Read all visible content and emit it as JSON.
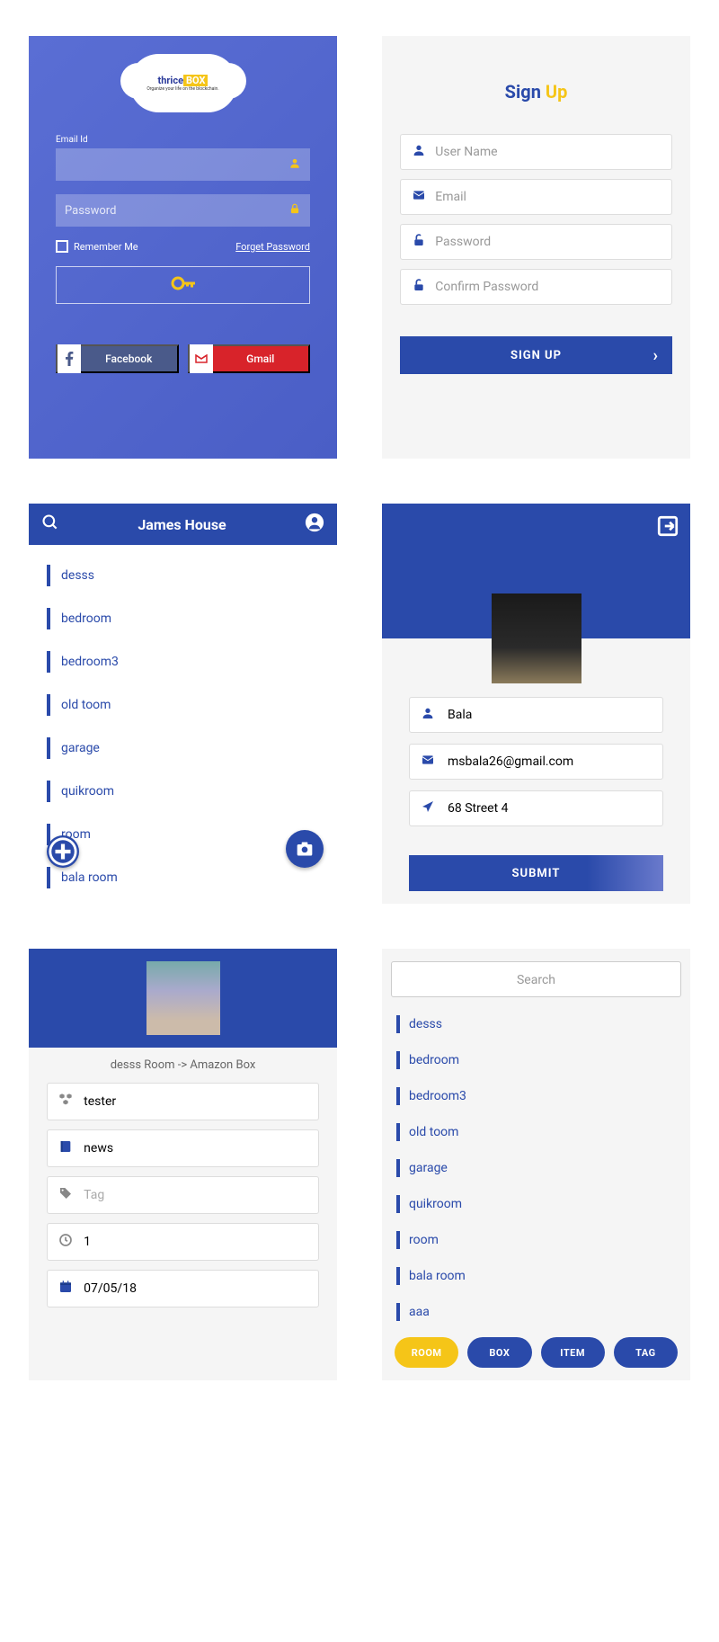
{
  "login": {
    "logo_text1": "thrice",
    "logo_text2": "BOX",
    "logo_sub": "Organize your life on the blockchain.",
    "email_label": "Email Id",
    "password_placeholder": "Password",
    "remember": "Remember Me",
    "forget": "Forget Password",
    "facebook": "Facebook",
    "gmail": "Gmail"
  },
  "signup": {
    "title1": "Sign",
    "title2": "Up",
    "username_ph": "User Name",
    "email_ph": "Email",
    "password_ph": "Password",
    "confirm_ph": "Confirm Password",
    "button": "SIGN UP"
  },
  "house": {
    "title": "James House",
    "rooms": [
      "desss",
      "bedroom",
      "bedroom3",
      "old toom",
      "garage",
      "quikroom",
      "room",
      "bala room"
    ]
  },
  "profile": {
    "name": "Bala",
    "email": "msbala26@gmail.com",
    "address": "68 Street 4",
    "submit": "SUBMIT"
  },
  "item": {
    "breadcrumb": "desss Room  ->  Amazon Box",
    "field1": "tester",
    "field2": "news",
    "field3_ph": "Tag",
    "field4": "1",
    "field5": "07/05/18"
  },
  "search": {
    "placeholder": "Search",
    "results": [
      "desss",
      "bedroom",
      "bedroom3",
      "old toom",
      "garage",
      "quikroom",
      "room",
      "bala room",
      "aaa"
    ],
    "filters": [
      "ROOM",
      "BOX",
      "ITEM",
      "TAG"
    ]
  }
}
